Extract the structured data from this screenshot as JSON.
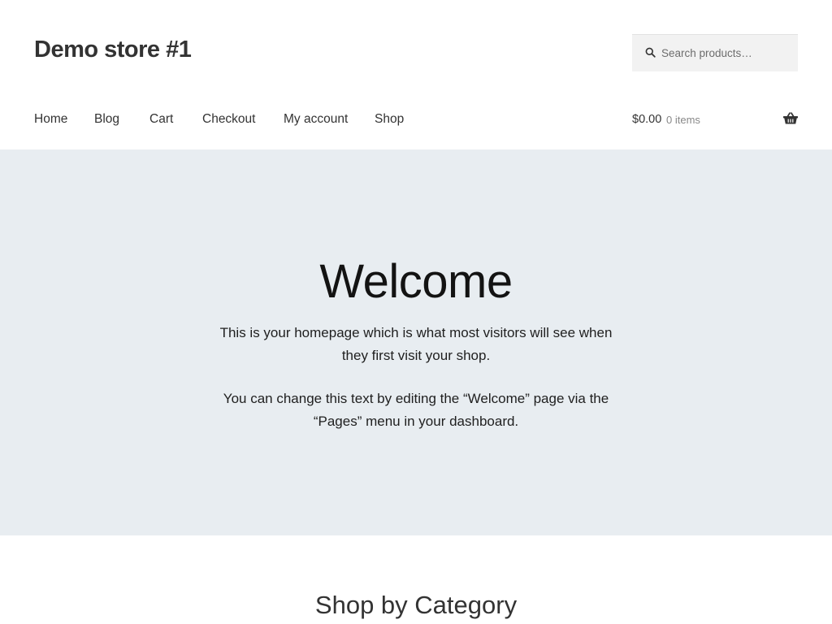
{
  "site": {
    "title": "Demo store #1"
  },
  "search": {
    "placeholder": "Search products…",
    "icon": "search-icon"
  },
  "nav": {
    "items": [
      {
        "label": "Home"
      },
      {
        "label": "Blog"
      },
      {
        "label": "Cart"
      },
      {
        "label": "Checkout"
      },
      {
        "label": "My account"
      },
      {
        "label": "Shop"
      }
    ]
  },
  "cart": {
    "amount": "$0.00",
    "count": "0 items",
    "icon": "basket-icon"
  },
  "hero": {
    "title": "Welcome",
    "paragraph1": "This is your homepage which is what most visitors will see when they first visit your shop.",
    "paragraph2": "You can change this text by editing the “Welcome” page via the “Pages” menu in your dashboard."
  },
  "section": {
    "title": "Shop by Category"
  },
  "colors": {
    "hero_background": "#e8edf1",
    "search_background": "#f2f2f2",
    "text": "#333333"
  }
}
